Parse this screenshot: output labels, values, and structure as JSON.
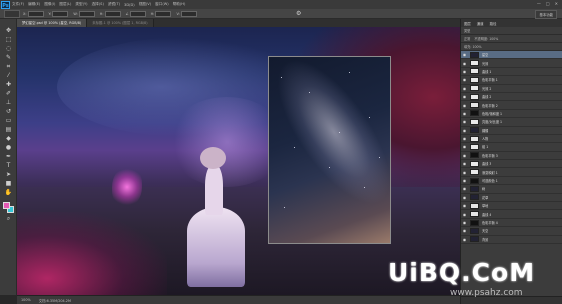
{
  "menubar": {
    "logo": "Ps",
    "items": [
      "文件(F)",
      "编辑(E)",
      "图像(I)",
      "图层(L)",
      "类型(Y)",
      "选择(S)",
      "滤镜(T)",
      "3D(D)",
      "视图(V)",
      "窗口(W)",
      "帮助(H)"
    ],
    "controls": [
      "—",
      "□",
      "✕"
    ]
  },
  "optionsbar": {
    "fields": [
      "X:",
      "Y:",
      "W:",
      "H:",
      "∠",
      "H:",
      "V:"
    ],
    "essentials": "基本功能"
  },
  "tabs": [
    {
      "label": "梦幻星空.psd @ 100% (星空, RGB/8)",
      "active": true
    },
    {
      "label": "未标题-1 @ 100% (图层 1, RGB/8)",
      "active": false
    }
  ],
  "toolbar": {
    "tools": [
      "move-icon",
      "marquee-icon",
      "lasso-icon",
      "quick-select-icon",
      "crop-icon",
      "eyedropper-icon",
      "healing-icon",
      "brush-icon",
      "stamp-icon",
      "history-brush-icon",
      "eraser-icon",
      "gradient-icon",
      "blur-icon",
      "dodge-icon",
      "pen-icon",
      "type-icon",
      "path-select-icon",
      "shape-icon",
      "hand-icon",
      "zoom-icon"
    ],
    "foreground_color": "#e35ab2",
    "background_color": "#37c7d6"
  },
  "statusbar": {
    "zoom": "100%",
    "doc_info": "文档:6.35M/204.2M"
  },
  "panel": {
    "tabs": [
      "图层",
      "通道",
      "路径"
    ],
    "filter_label": "类型",
    "blend_mode": "正常",
    "opacity": "不透明度: 100%",
    "fill": "填充: 100%",
    "layers": [
      {
        "name": "星空",
        "selected": true,
        "thumb": "dark"
      },
      {
        "name": "光效",
        "selected": false,
        "thumb": "light"
      },
      {
        "name": "曲线 1",
        "selected": false,
        "thumb": "light"
      },
      {
        "name": "色彩平衡 1",
        "selected": false,
        "thumb": "light"
      },
      {
        "name": "光效 2",
        "selected": false,
        "thumb": "light"
      },
      {
        "name": "曲线 2",
        "selected": false,
        "thumb": "light"
      },
      {
        "name": "色彩平衡 2",
        "selected": false,
        "thumb": "light"
      },
      {
        "name": "色相/饱和度 1",
        "selected": false,
        "thumb": "mask"
      },
      {
        "name": "亮度/对比度 1",
        "selected": false,
        "thumb": "light"
      },
      {
        "name": "蝴蝶",
        "selected": false,
        "thumb": "dark"
      },
      {
        "name": "人物",
        "selected": false,
        "thumb": "light"
      },
      {
        "name": "组 1",
        "selected": false,
        "thumb": "light"
      },
      {
        "name": "色彩平衡 3",
        "selected": false,
        "thumb": "mask"
      },
      {
        "name": "曲线 3",
        "selected": false,
        "thumb": "light"
      },
      {
        "name": "渐变映射 1",
        "selected": false,
        "thumb": "light"
      },
      {
        "name": "可选颜色 1",
        "selected": false,
        "thumb": "mask"
      },
      {
        "name": "树",
        "selected": false,
        "thumb": "dark"
      },
      {
        "name": "花草",
        "selected": false,
        "thumb": "dark"
      },
      {
        "name": "草地",
        "selected": false,
        "thumb": "light"
      },
      {
        "name": "曲线 4",
        "selected": false,
        "thumb": "light"
      },
      {
        "name": "色彩平衡 4",
        "selected": false,
        "thumb": "mask"
      },
      {
        "name": "天空",
        "selected": false,
        "thumb": "dark"
      },
      {
        "name": "背景",
        "selected": false,
        "thumb": "dark"
      }
    ]
  },
  "watermark": {
    "main": "UiBQ.CoM",
    "sub": "www.psahz.com"
  }
}
